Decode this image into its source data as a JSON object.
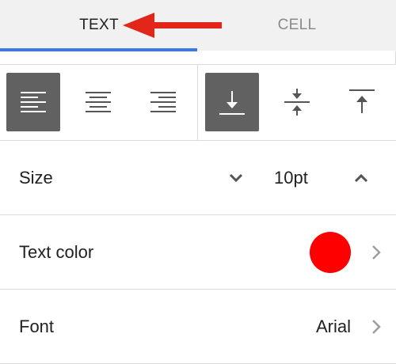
{
  "tabs": [
    {
      "label": "TEXT",
      "active": true
    },
    {
      "label": "CELL",
      "active": false
    }
  ],
  "colors": {
    "accent": "#3b78e7",
    "annotation_arrow": "#e3261a",
    "selected_button": "#616161",
    "text_color_swatch": "#ff0000"
  },
  "horizontal_align": {
    "options": [
      "align-left-icon",
      "align-center-icon",
      "align-right-icon"
    ],
    "selected": "align-left-icon"
  },
  "vertical_align": {
    "options": [
      "align-bottom-icon",
      "align-middle-icon",
      "align-top-icon"
    ],
    "selected": "align-bottom-icon"
  },
  "size": {
    "label": "Size",
    "value": "10pt"
  },
  "text_color": {
    "label": "Text color"
  },
  "font": {
    "label": "Font",
    "value": "Arial"
  }
}
